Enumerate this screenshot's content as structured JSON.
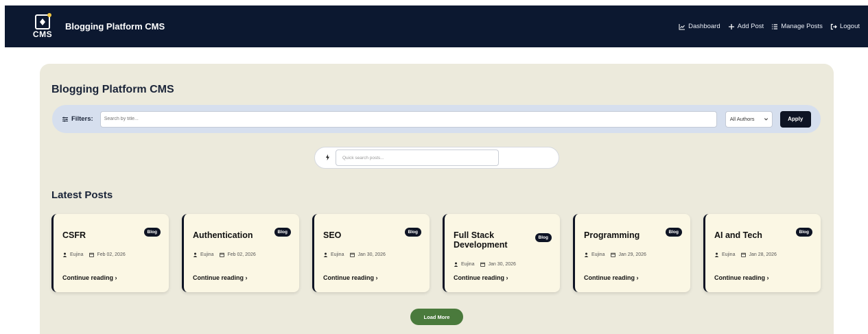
{
  "navbar": {
    "logo_text": "CMS",
    "title": "Blogging Platform CMS",
    "links": [
      {
        "label": "Dashboard",
        "icon": "chart-line-icon"
      },
      {
        "label": "Add Post",
        "icon": "plus-icon"
      },
      {
        "label": "Manage Posts",
        "icon": "list-icon"
      },
      {
        "label": "Logout",
        "icon": "logout-icon"
      }
    ]
  },
  "main": {
    "title": "Blogging Platform CMS",
    "filters": {
      "label": "Filters:",
      "search_placeholder": "Search by title...",
      "author_selected": "All Authors",
      "apply_label": "Apply"
    },
    "quick_search": {
      "placeholder": "Quick search posts..."
    },
    "latest_title": "Latest Posts",
    "posts": [
      {
        "title": "CSFR",
        "badge": "Blog",
        "author": "Eujina",
        "date": "Feb 02, 2026",
        "link": "Continue reading ›"
      },
      {
        "title": "Authentication",
        "badge": "Blog",
        "author": "Eujina",
        "date": "Feb 02, 2026",
        "link": "Continue reading ›"
      },
      {
        "title": "SEO",
        "badge": "Blog",
        "author": "Eujina",
        "date": "Jan 30, 2026",
        "link": "Continue reading ›"
      },
      {
        "title": "Full Stack Development",
        "badge": "Blog",
        "author": "Eujina",
        "date": "Jan 30, 2026",
        "link": "Continue reading ›"
      },
      {
        "title": "Programming",
        "badge": "Blog",
        "author": "Eujina",
        "date": "Jan 29, 2026",
        "link": "Continue reading ›"
      },
      {
        "title": "AI and Tech",
        "badge": "Blog",
        "author": "Eujina",
        "date": "Jan 28, 2026",
        "link": "Continue reading ›"
      }
    ],
    "load_more_label": "Load More"
  },
  "colors": {
    "navbar_bg": "#0c1830",
    "panel_bg": "#eceadc",
    "card_bg": "#fbf7e4",
    "load_more_bg": "#4a7a3c"
  }
}
